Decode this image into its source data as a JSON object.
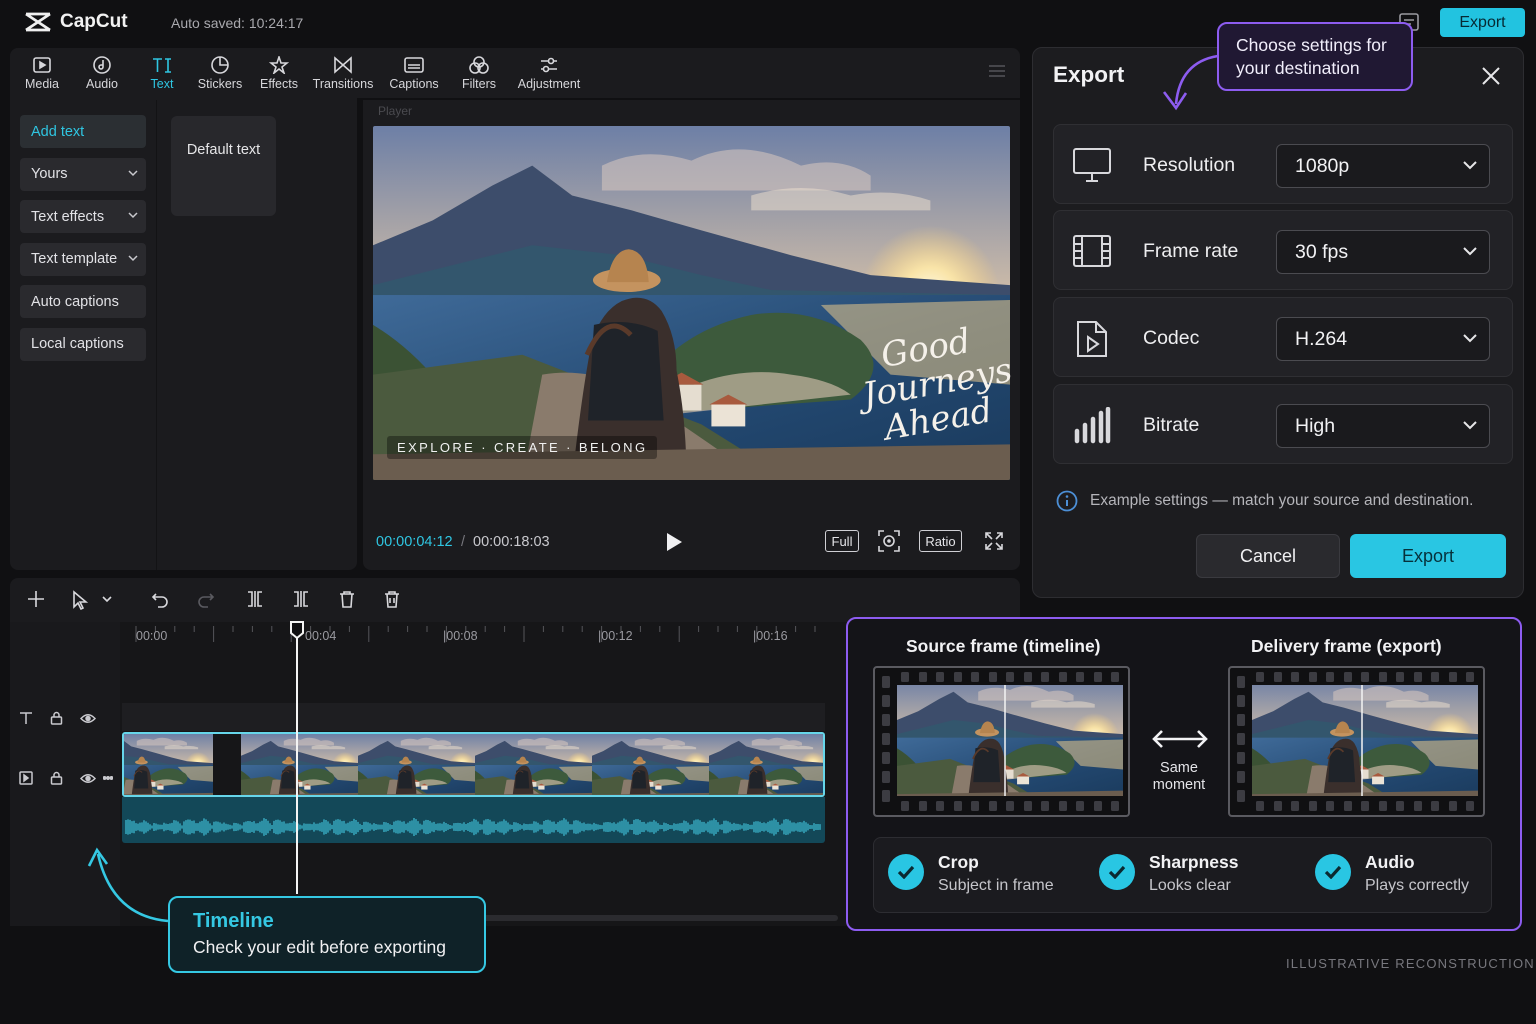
{
  "app": {
    "name": "CapCut",
    "autosave": "Auto saved: 10:24:17",
    "export_label": "Export"
  },
  "toolbar": {
    "items": [
      {
        "label": "Media",
        "icon": "media-icon"
      },
      {
        "label": "Audio",
        "icon": "audio-icon"
      },
      {
        "label": "Text",
        "icon": "text-icon",
        "active": true
      },
      {
        "label": "Stickers",
        "icon": "sticker-icon"
      },
      {
        "label": "Effects",
        "icon": "effects-icon"
      },
      {
        "label": "Transitions",
        "icon": "transitions-icon"
      },
      {
        "label": "Captions",
        "icon": "captions-icon"
      },
      {
        "label": "Filters",
        "icon": "filters-icon"
      },
      {
        "label": "Adjustment",
        "icon": "adjustment-icon"
      }
    ]
  },
  "sidebar": {
    "items": [
      {
        "label": "Add text",
        "active": true
      },
      {
        "label": "Yours",
        "dropdown": true
      },
      {
        "label": "Text effects",
        "dropdown": true
      },
      {
        "label": "Text template",
        "dropdown": true
      },
      {
        "label": "Auto captions"
      },
      {
        "label": "Local captions"
      }
    ],
    "card_label": "Default text"
  },
  "player": {
    "label": "Player",
    "overlay_caption": "EXPLORE · CREATE · BELONG",
    "overlay_script": "Good Journeys Ahead",
    "current_time": "00:00:04:12",
    "separator": "/",
    "total_time": "00:00:18:03",
    "buttons": {
      "full": "Full",
      "ratio": "Ratio"
    }
  },
  "timeline": {
    "ticks": [
      "00:00",
      "00:04",
      "|00:08",
      "|00:12",
      "|00:16"
    ],
    "callout_title": "Timeline",
    "callout_text": "Check your edit before exporting"
  },
  "export_dialog": {
    "title": "Export",
    "callout": "Choose settings for your destination",
    "settings": [
      {
        "label": "Resolution",
        "value": "1080p",
        "icon": "monitor-icon"
      },
      {
        "label": "Frame rate",
        "value": "30 fps",
        "icon": "film-icon"
      },
      {
        "label": "Codec",
        "value": "H.264",
        "icon": "file-play-icon"
      },
      {
        "label": "Bitrate",
        "value": "High",
        "icon": "signal-bars-icon"
      }
    ],
    "info": "Example settings — match your source and destination.",
    "cancel_label": "Cancel",
    "export_label": "Export"
  },
  "comparison": {
    "source_title": "Source frame (timeline)",
    "delivery_title": "Delivery frame (export)",
    "same_moment": "Same moment",
    "checks": [
      {
        "title": "Crop",
        "subtitle": "Subject in frame"
      },
      {
        "title": "Sharpness",
        "subtitle": "Looks clear"
      },
      {
        "title": "Audio",
        "subtitle": "Plays correctly"
      }
    ]
  },
  "footer_note": "ILLUSTRATIVE RECONSTRUCTION",
  "colors": {
    "accent": "#29c6e3",
    "purple": "#8d5cf0",
    "background": "#101012"
  }
}
